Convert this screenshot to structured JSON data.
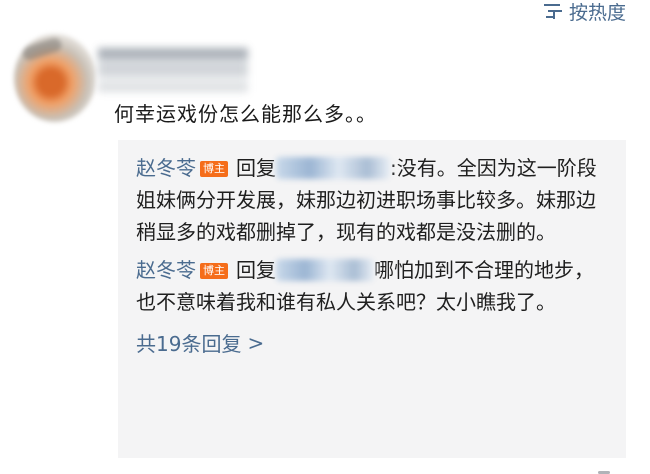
{
  "header": {
    "sort_label": "按热度",
    "sort_icon": "sort-icon"
  },
  "comment": {
    "avatar": "avatar",
    "text": "何幸运戏份怎么能那么多。。"
  },
  "replies": [
    {
      "author": "赵冬苓",
      "badge": "博主",
      "reply_word": "回复",
      "text": ":没有。全因为这一阶段姐妹俩分开发展，妹那边初进职场事比较多。妹那边稍显多的戏都删掉了，现有的戏都是没法删的。"
    },
    {
      "author": "赵冬苓",
      "badge": "博主",
      "reply_word": "回复",
      "text": "哪怕加到不合理的地步，也不意味着我和谁有私人关系吧？太小瞧我了。"
    }
  ],
  "more": {
    "label": "共19条回复",
    "chevron": ">"
  },
  "colors": {
    "link": "#4a6b8f",
    "badge": "#f56d1a",
    "reply_bg": "#f4f4f5"
  }
}
